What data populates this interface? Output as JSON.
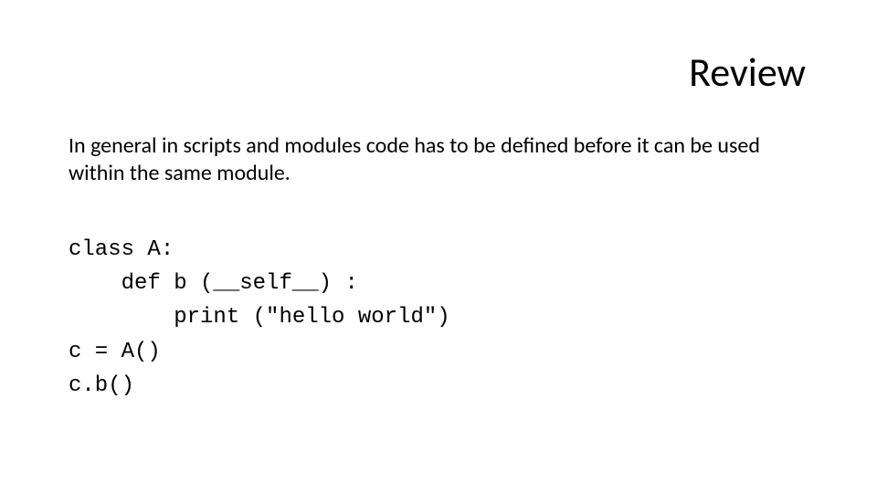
{
  "title": "Review",
  "body_text": "In general in scripts and modules code has to be defined before it can be used within the same module.",
  "code": {
    "line1": "class A:",
    "line2": "    def b (__self__) :",
    "line3": "        print (\"hello world\")",
    "line4": "c = A()",
    "line5": "c.b()"
  }
}
